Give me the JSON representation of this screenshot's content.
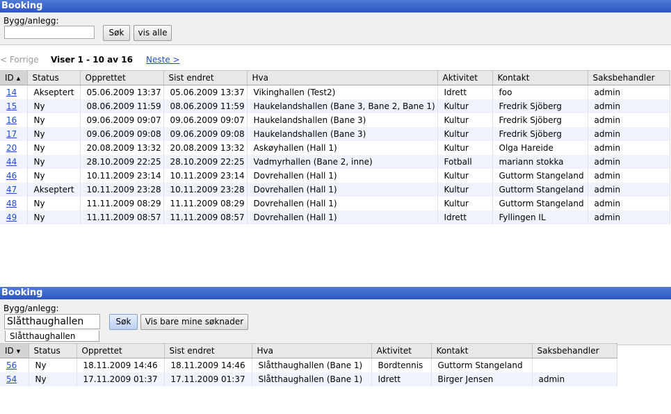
{
  "panel1": {
    "title": "Booking",
    "search": {
      "label": "Bygg/anlegg:",
      "value": "",
      "placeholder": ""
    },
    "buttons": {
      "search": "Søk",
      "show_all": "vis alle"
    },
    "pager": {
      "prev": "< Forrige",
      "info": "Viser 1 - 10 av 16",
      "next": "Neste >"
    },
    "columns": [
      "ID",
      "Status",
      "Opprettet",
      "Sist endret",
      "Hva",
      "Aktivitet",
      "Kontakt",
      "Saksbehandler"
    ],
    "rows": [
      [
        "14",
        "Akseptert",
        "05.06.2009 13:37",
        "05.06.2009 13:37",
        "Vikinghallen (Test2)",
        "Idrett",
        "foo",
        "admin"
      ],
      [
        "15",
        "Ny",
        "08.06.2009 11:59",
        "08.06.2009 11:59",
        "Haukelandshallen (Bane 3, Bane 2, Bane 1)",
        "Kultur",
        "Fredrik Sjöberg",
        "admin"
      ],
      [
        "16",
        "Ny",
        "09.06.2009 09:07",
        "09.06.2009 09:07",
        "Haukelandshallen (Bane 3)",
        "Kultur",
        "Fredrik Sjöberg",
        "admin"
      ],
      [
        "17",
        "Ny",
        "09.06.2009 09:08",
        "09.06.2009 09:08",
        "Haukelandshallen (Bane 3)",
        "Kultur",
        "Fredrik Sjöberg",
        "admin"
      ],
      [
        "20",
        "Ny",
        "20.08.2009 13:32",
        "20.08.2009 13:32",
        "Askøyhallen (Hall 1)",
        "Kultur",
        "Olga Hareide",
        "admin"
      ],
      [
        "44",
        "Ny",
        "28.10.2009 22:25",
        "28.10.2009 22:25",
        "Vadmyrhallen (Bane 2, inne)",
        "Fotball",
        "mariann stokka",
        "admin"
      ],
      [
        "46",
        "Ny",
        "10.11.2009 23:14",
        "10.11.2009 23:14",
        "Dovrehallen (Hall 1)",
        "Kultur",
        "Guttorm Stangeland",
        "admin"
      ],
      [
        "47",
        "Akseptert",
        "10.11.2009 23:28",
        "10.11.2009 23:28",
        "Dovrehallen (Hall 1)",
        "Kultur",
        "Guttorm Stangeland",
        "admin"
      ],
      [
        "48",
        "Ny",
        "11.11.2009 08:29",
        "11.11.2009 08:29",
        "Dovrehallen (Hall 1)",
        "Kultur",
        "Guttorm Stangeland",
        "admin"
      ],
      [
        "49",
        "Ny",
        "11.11.2009 08:57",
        "11.11.2009 08:57",
        "Dovrehallen (Hall 1)",
        "Idrett",
        "Fyllingen IL",
        "admin"
      ]
    ]
  },
  "panel2": {
    "title": "Booking",
    "search": {
      "label": "Bygg/anlegg:",
      "value": "Slåtthaughallen",
      "placeholder": ""
    },
    "buttons": {
      "search": "Søk",
      "mine_only": "Vis bare mine søknader"
    },
    "autocomplete": [
      "Slåtthaughallen"
    ],
    "columns": [
      "ID",
      "Status",
      "Opprettet",
      "Sist endret",
      "Hva",
      "Aktivitet",
      "Kontakt",
      "Saksbehandler"
    ],
    "rows": [
      [
        "56",
        "Ny",
        "18.11.2009 14:46",
        "18.11.2009 14:46",
        "Slåtthaughallen (Bane 1)",
        "Bordtennis",
        "Guttorm Stangeland",
        ""
      ],
      [
        "54",
        "Ny",
        "17.11.2009 01:37",
        "17.11.2009 01:37",
        "Slåtthaughallen (Bane 1)",
        "Idrett",
        "Birger Jensen",
        "admin"
      ]
    ]
  },
  "colors": {
    "titlebar": "#2e57c2",
    "link": "#1f4fcf",
    "row_alt": "#eef3fc"
  }
}
